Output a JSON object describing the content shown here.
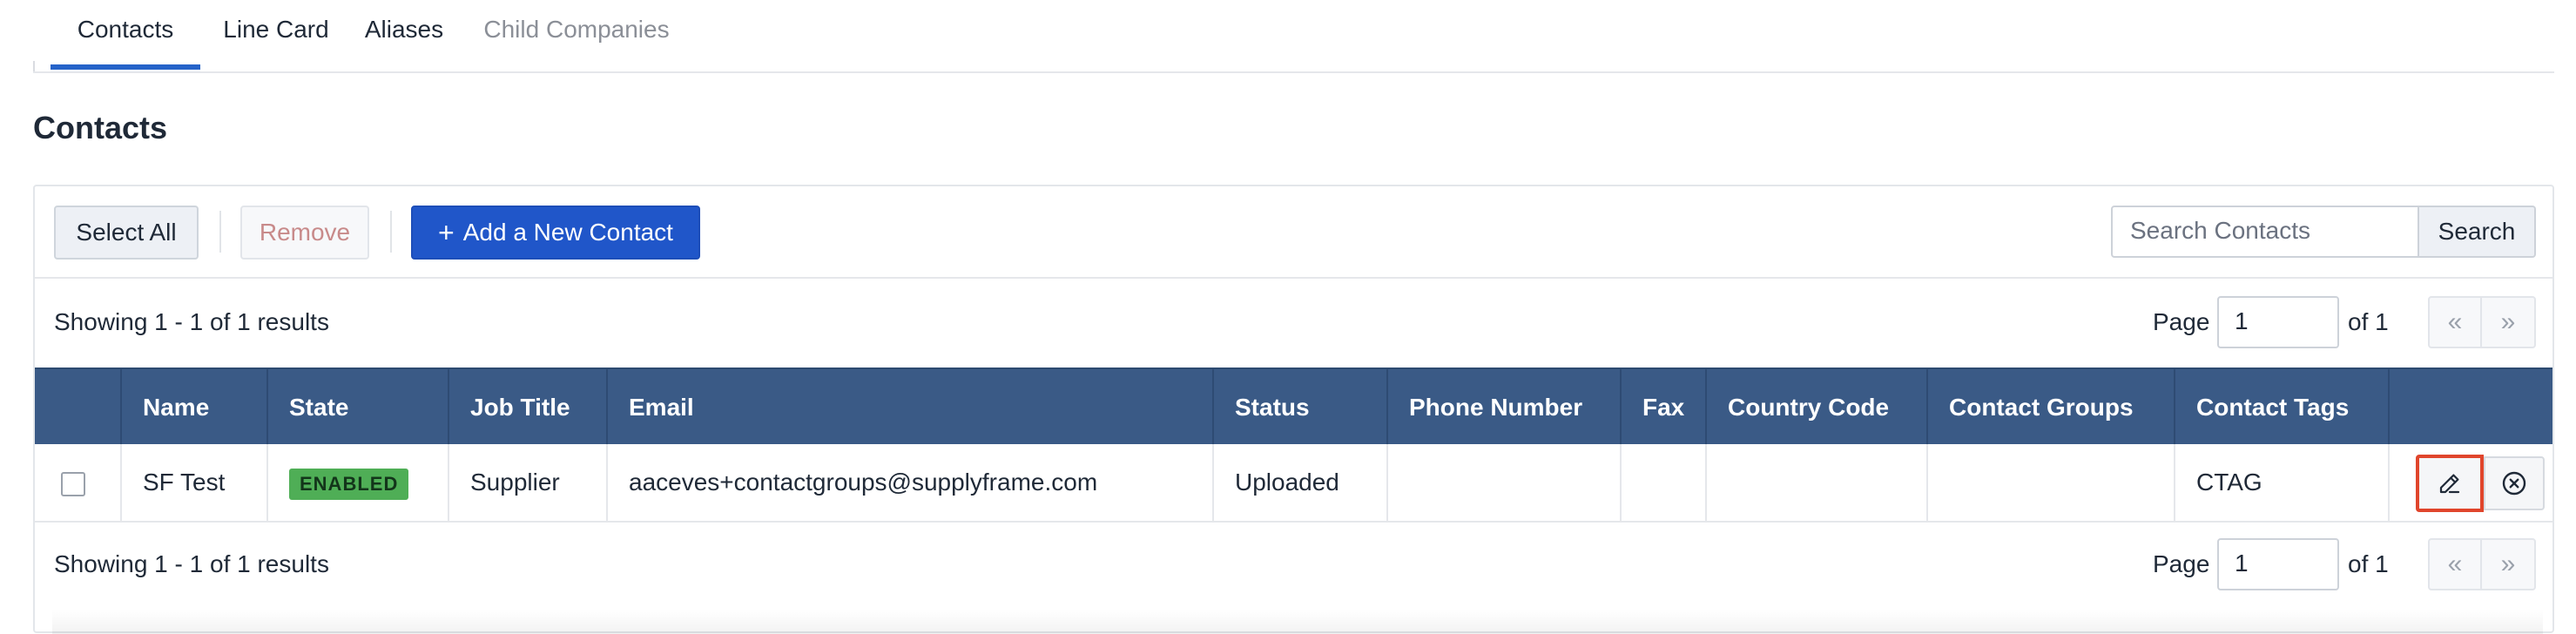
{
  "tabs": [
    {
      "label": "Contacts",
      "state": "active"
    },
    {
      "label": "Line Card",
      "state": "normal"
    },
    {
      "label": "Aliases",
      "state": "normal"
    },
    {
      "label": "Child Companies",
      "state": "disabled"
    }
  ],
  "page_title": "Contacts",
  "toolbar": {
    "select_all": "Select All",
    "remove": "Remove",
    "add_new": "Add a New Contact",
    "add_icon": "+",
    "search_placeholder": "Search Contacts",
    "search_button": "Search"
  },
  "results_top": "Showing 1 - 1 of 1 results",
  "results_bottom": "Showing 1 - 1 of 1 results",
  "pager": {
    "page_label": "Page",
    "page_value": "1",
    "of_label": "of 1",
    "first": "«",
    "last": "»"
  },
  "table": {
    "headers": [
      "",
      "Name",
      "State",
      "Job Title",
      "Email",
      "Status",
      "Phone Number",
      "Fax",
      "Country Code",
      "Contact Groups",
      "Contact Tags",
      ""
    ],
    "rows": [
      {
        "name": "SF Test",
        "state": "ENABLED",
        "job_title": "Supplier",
        "email": "aaceves+contactgroups@supplyframe.com",
        "status": "Uploaded",
        "phone": "",
        "fax": "",
        "country_code": "",
        "contact_groups": "",
        "contact_tags": "CTAG"
      }
    ]
  },
  "colors": {
    "accent": "#2563c9",
    "header_bg": "#3a5a86",
    "badge_green": "#4fae56",
    "highlight_red": "#e0452c"
  }
}
